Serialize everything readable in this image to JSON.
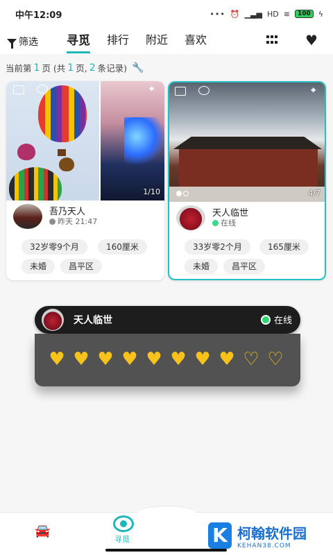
{
  "status": {
    "time": "中午12:09",
    "network": "HD",
    "battery": "100"
  },
  "topnav": {
    "filter_label": "筛选",
    "tabs": [
      {
        "label": "寻觅",
        "active": true
      },
      {
        "label": "排行",
        "active": false
      },
      {
        "label": "附近",
        "active": false
      },
      {
        "label": "喜欢",
        "active": false
      }
    ]
  },
  "pageinfo": {
    "prefix": "当前第",
    "current": "1",
    "mid1": "页 (共",
    "total_pages": "1",
    "mid2": "页,",
    "records": "2",
    "suffix": "条记录)"
  },
  "cards": [
    {
      "photo_count": "1/10",
      "name": "吾乃天人",
      "status": "昨天 21:47",
      "status_color": "#8c8c8c",
      "tags": [
        "32岁零9个月",
        "160厘米",
        "未婚",
        "昌平区"
      ]
    },
    {
      "photo_count": "4/7",
      "name": "天人临世",
      "status": "在线",
      "status_color": "#3dd68a",
      "tags": [
        "33岁零2个月",
        "165厘米",
        "未婚",
        "昌平区"
      ]
    }
  ],
  "overlay": {
    "name": "天人临世",
    "status": "在线",
    "rating_full": 8,
    "rating_total": 10
  },
  "bottomnav": {
    "active_label": "寻觅"
  },
  "watermark": {
    "title": "柯翰软件园",
    "subtitle": "KEHAN38.COM",
    "logo_letter": "K"
  },
  "colors": {
    "accent": "#1fb6b8",
    "heart": "#f7c21c",
    "online": "#2ed573"
  }
}
